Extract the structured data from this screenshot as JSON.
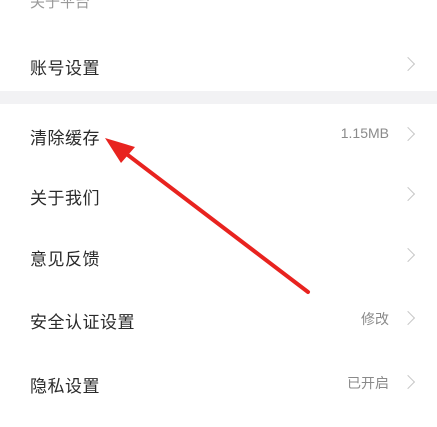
{
  "top_partial_text": "关于平台",
  "settings": {
    "items": [
      {
        "label": "账号设置",
        "value": ""
      },
      {
        "label": "清除缓存",
        "value": "1.15MB"
      },
      {
        "label": "关于我们",
        "value": ""
      },
      {
        "label": "意见反馈",
        "value": ""
      },
      {
        "label": "安全认证设置",
        "value": "修改"
      },
      {
        "label": "隐私设置",
        "value": "已开启"
      }
    ]
  },
  "annotation": {
    "color": "#e8231f"
  }
}
